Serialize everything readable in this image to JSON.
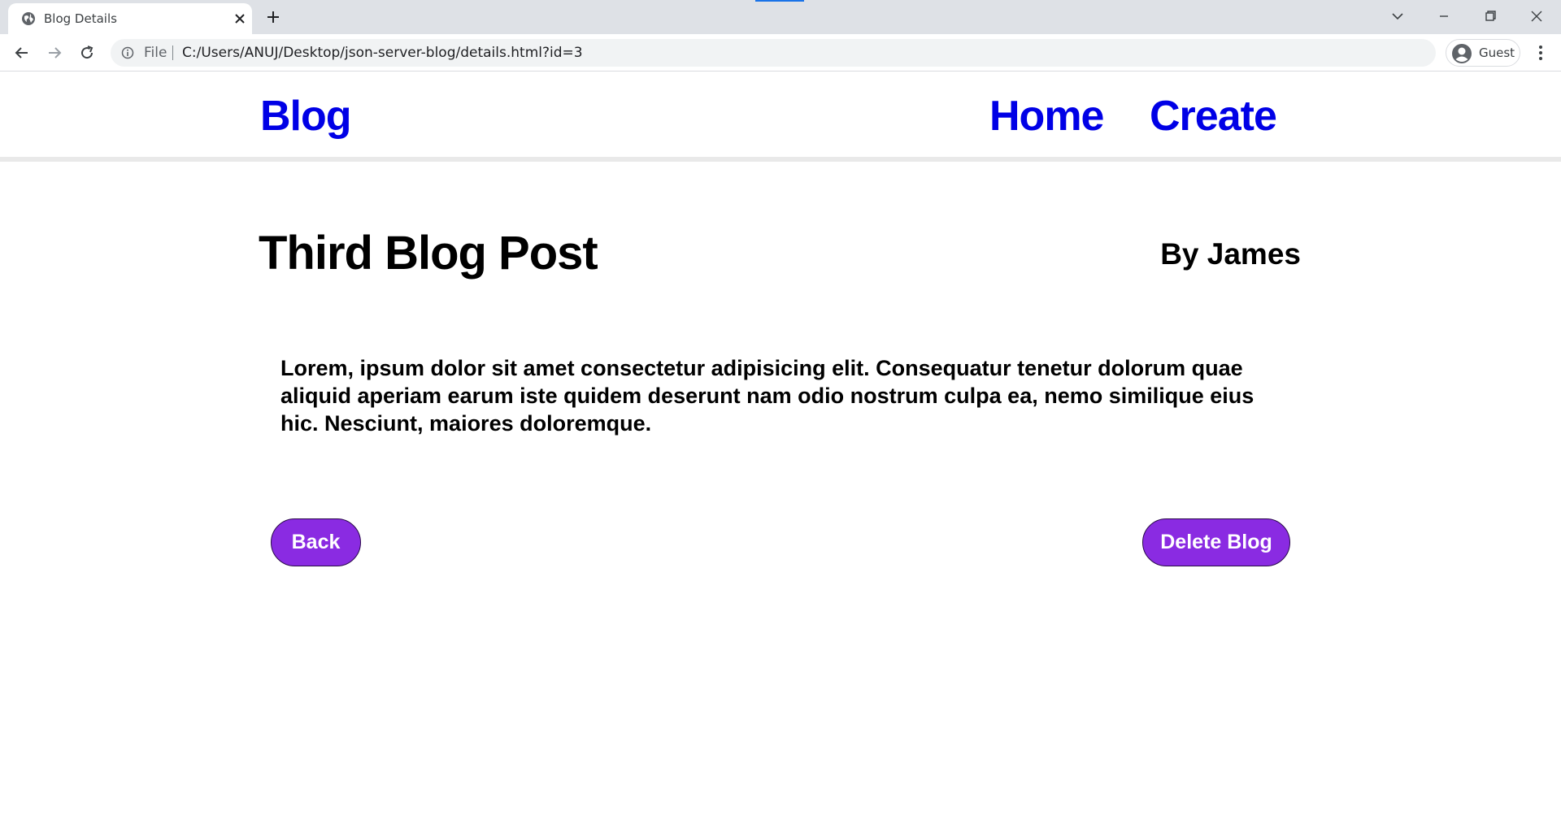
{
  "browser": {
    "tab": {
      "title": "Blog Details",
      "favicon": "globe-icon"
    },
    "new_tab_icon": "plus-icon",
    "address_bar": {
      "scheme_label": "File",
      "url": "C:/Users/ANUJ/Desktop/json-server-blog/details.html?id=3"
    },
    "profile": {
      "label": "Guest"
    },
    "accent_color": "#1a73e8"
  },
  "site": {
    "brand": "Blog",
    "nav": [
      {
        "label": "Home"
      },
      {
        "label": "Create"
      }
    ],
    "link_color": "#0000e6"
  },
  "post": {
    "title": "Third Blog Post",
    "author": "By James",
    "body": "Lorem, ipsum dolor sit amet consectetur adipisicing elit. Consequatur tenetur dolorum quae aliquid aperiam earum iste quidem deserunt nam odio nostrum culpa ea, nemo similique eius hic. Nesciunt, maiores doloremque."
  },
  "actions": {
    "back_label": "Back",
    "delete_label": "Delete Blog",
    "button_color": "#8a2be2"
  }
}
